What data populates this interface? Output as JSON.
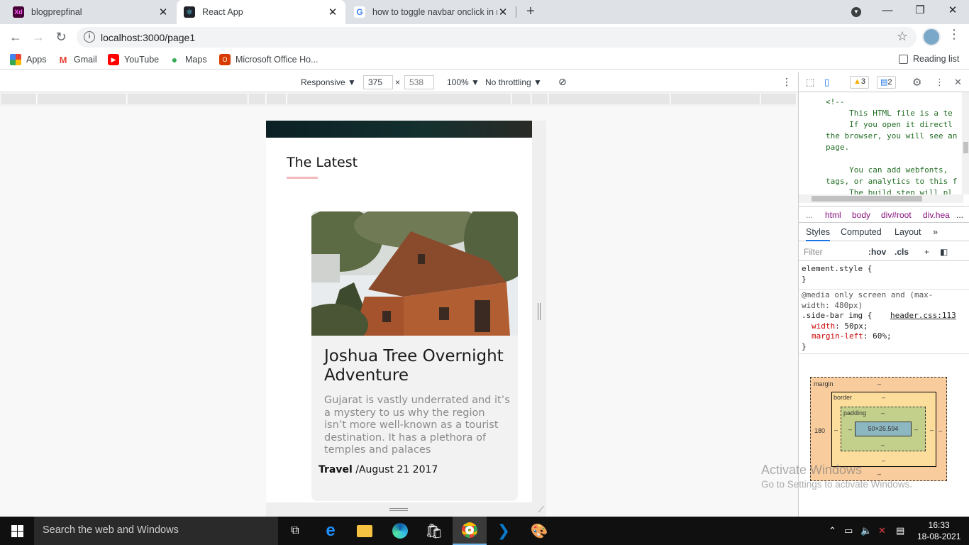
{
  "browser": {
    "tabs": [
      {
        "title": "blogprepfinal",
        "favicon": "xd-icon",
        "active": false
      },
      {
        "title": "React App",
        "favicon": "react-icon",
        "active": true
      },
      {
        "title": "how to toggle navbar onclick in r",
        "favicon": "google-icon",
        "active": false
      }
    ],
    "url": "localhost:3000/page1",
    "bookmarks": [
      "Apps",
      "Gmail",
      "YouTube",
      "Maps",
      "Microsoft Office Ho..."
    ],
    "reading_list": "Reading list"
  },
  "device_toolbar": {
    "mode": "Responsive",
    "width": "375",
    "x": "×",
    "height": "538",
    "zoom": "100%",
    "throttling": "No throttling"
  },
  "page": {
    "section_title": "The Latest",
    "card": {
      "title": "Joshua Tree Overnight Adventure",
      "description": "Gujarat is vastly underrated and it’s a mystery to us why the region isn’t more well-known as a tourist destination. It has a plethora of temples and palaces",
      "category": "Travel",
      "date": " /August 21 2017"
    }
  },
  "devtools": {
    "warnings": "3",
    "messages": "2",
    "source_lines": "<!--\n     This HTML file is a te\n     If you open it directl\nthe browser, you will see an\npage.\n\n     You can add webfonts,\ntags, or analytics to this f\n     The build step will pl",
    "breadcrumbs": [
      "...",
      "html",
      "body",
      "div#root",
      "div.hea",
      "..."
    ],
    "subtabs": [
      "Styles",
      "Computed",
      "Layout",
      "»"
    ],
    "filter_placeholder": "Filter",
    "hov": ":hov",
    "cls": ".cls",
    "rules": {
      "element_style": "element.style {",
      "close": "}",
      "media": "@media only screen and (max-width: 480px)",
      "selector": ".side-bar img {",
      "source": "header.css:113",
      "width_prop": "width",
      "width_val": ": 50px;",
      "margin_prop": "margin-left",
      "margin_val": ": 60%;"
    },
    "box_model": {
      "margin": "margin",
      "border": "border",
      "padding": "padding",
      "content": "50×26.594",
      "margin_left": "180",
      "dash": "–"
    }
  },
  "watermark": {
    "line1": "Activate Windows",
    "line2": "Go to Settings to activate Windows."
  },
  "taskbar": {
    "search_placeholder": "Search the web and Windows",
    "time": "16:33",
    "date": "18-08-2021"
  }
}
